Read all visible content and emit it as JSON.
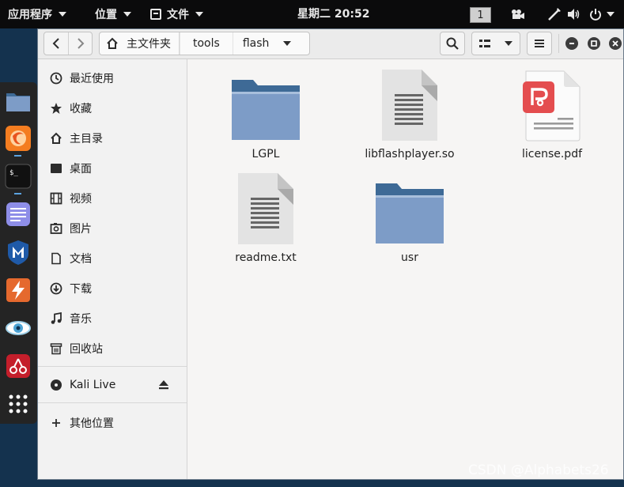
{
  "top_panel": {
    "apps_menu": "应用程序",
    "places_menu": "位置",
    "files_menu": "文件",
    "clock": "星期二 20:52",
    "workspace": "1"
  },
  "dock": {
    "items": [
      "files-icon",
      "firefox-icon",
      "terminal-icon",
      "text-editor-icon",
      "metasploit-icon",
      "burpsuite-icon",
      "eye-icon",
      "cherrytree-icon",
      "app-grid-icon"
    ]
  },
  "headerbar": {
    "path": [
      "主文件夹",
      "tools",
      "flash"
    ]
  },
  "sidebar": {
    "items": [
      {
        "label": "最近使用",
        "icon": "clock-icon"
      },
      {
        "label": "收藏",
        "icon": "star-icon"
      },
      {
        "label": "主目录",
        "icon": "home-icon"
      },
      {
        "label": "桌面",
        "icon": "desktop-icon"
      },
      {
        "label": "视频",
        "icon": "video-icon"
      },
      {
        "label": "图片",
        "icon": "picture-icon"
      },
      {
        "label": "文档",
        "icon": "document-icon"
      },
      {
        "label": "下载",
        "icon": "download-icon"
      },
      {
        "label": "音乐",
        "icon": "music-icon"
      },
      {
        "label": "回收站",
        "icon": "trash-icon"
      }
    ],
    "device": "Kali Live",
    "other": "其他位置"
  },
  "files": [
    {
      "name": "LGPL",
      "type": "folder"
    },
    {
      "name": "libflashplayer.so",
      "type": "text"
    },
    {
      "name": "license.pdf",
      "type": "pdf"
    },
    {
      "name": "readme.txt",
      "type": "text"
    },
    {
      "name": "usr",
      "type": "folder"
    }
  ],
  "watermark": "CSDN @Alphabets26",
  "colors": {
    "panel": "#0b0b0c",
    "folder": "#7d9cc7",
    "folder_tab": "#3e6a96",
    "pdf_red": "#e44d4f"
  }
}
